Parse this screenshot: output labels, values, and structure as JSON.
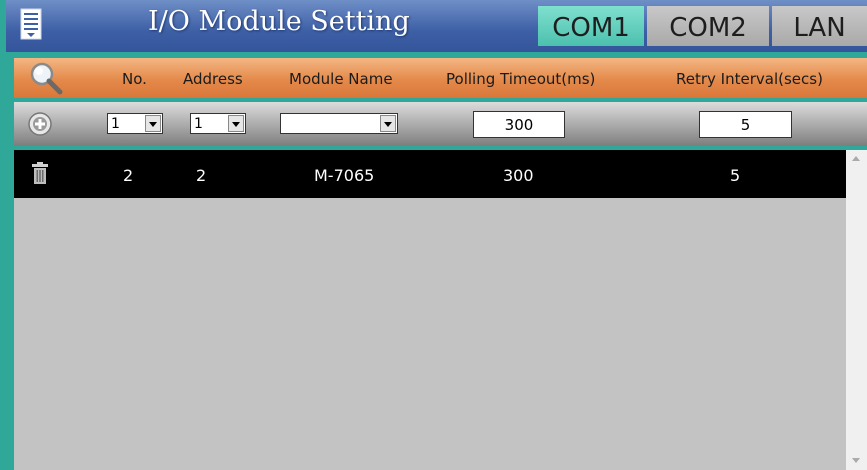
{
  "titlebar": {
    "title": "I/O Module Setting",
    "menu_icon": "list-menu-icon",
    "tabs": [
      {
        "label": "COM1",
        "active": true
      },
      {
        "label": "COM2",
        "active": false
      },
      {
        "label": "LAN",
        "active": false
      }
    ]
  },
  "header": {
    "search_icon": "magnifier-icon",
    "columns": [
      "No.",
      "Address",
      "Module Name",
      "Polling Timeout(ms)",
      "Retry Interval(secs)"
    ]
  },
  "inputs": {
    "add_icon": "plus-circle-icon",
    "no_value": "1",
    "address_value": "1",
    "module_name_value": "",
    "polling_timeout_value": "300",
    "retry_interval_value": "5"
  },
  "rows": [
    {
      "no": "2",
      "address": "2",
      "module_name": "M-7065",
      "polling_timeout": "300",
      "retry_interval": "5",
      "icon": "trash-icon"
    }
  ],
  "colors": {
    "frame": "#2fa89a",
    "titlebar": "#3d5fa5",
    "active_tab": "#4dc0ae",
    "header": "#e48a4a",
    "row_bg": "#000000",
    "table_bg": "#c3c3c3"
  }
}
